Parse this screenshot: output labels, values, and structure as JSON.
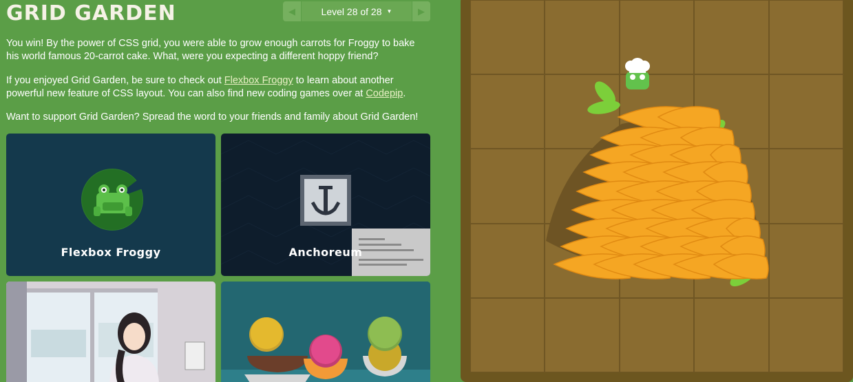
{
  "header": {
    "title": "GRID GARDEN",
    "level_label": "Level 28 of 28"
  },
  "content": {
    "p1": "You win! By the power of CSS grid, you were able to grow enough carrots for Froggy to bake his world famous 20-carrot cake. What, were you expecting a different hoppy friend?",
    "p2_before": "If you enjoyed Grid Garden, be sure to check out ",
    "p2_link1": "Flexbox Froggy",
    "p2_middle": " to learn about another powerful new feature of CSS layout. You can also find new coding games over at ",
    "p2_link2": "Codepip",
    "p2_after": ".",
    "p3": "Want to support Grid Garden? Spread the word to your friends and family about Grid Garden!"
  },
  "cards": [
    {
      "label": "Flexbox Froggy"
    },
    {
      "label": "Anchoreum"
    }
  ],
  "colors": {
    "background": "#5b9e47",
    "garden_border": "#6c561f",
    "soil": "#8a6c30",
    "carrot": "#f5a623",
    "leaf": "#7ccf3a",
    "link": "#e9f0c5"
  },
  "icons": {
    "prev_level": "triangle-left",
    "next_level": "triangle-right",
    "level_menu": "caret-down"
  }
}
